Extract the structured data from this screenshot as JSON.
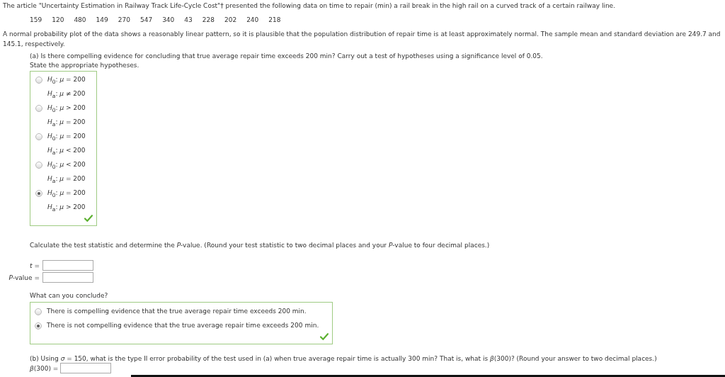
{
  "intro": "The article \"Uncertainty Estimation in Railway Track Life-Cycle Cost\"† presented the following data on time to repair (min) a rail break in the high rail on a curved track of a certain railway line.",
  "data_values": [
    "159",
    "120",
    "480",
    "149",
    "270",
    "547",
    "340",
    "43",
    "228",
    "202",
    "240",
    "218"
  ],
  "description": "A normal probability plot of the data shows a reasonably linear pattern, so it is plausible that the population distribution of repair time is at least approximately normal. The sample mean and standard deviation are 249.7 and 145.1, respectively.",
  "part_a": {
    "question": "(a) Is there compelling evidence for concluding that true average repair time exceeds 200 min? Carry out a test of hypotheses using a significance level of 0.05.",
    "prompt": "State the appropriate hypotheses.",
    "correct": true,
    "options": [
      {
        "h0": "*H*$_{0}$: *μ* = 200",
        "ha": "*H*$_{a}$: *μ* ≠ 200",
        "selected": false
      },
      {
        "h0": "*H*$_{0}$: *μ* > 200",
        "ha": "*H*$_{a}$: *μ* = 200",
        "selected": false
      },
      {
        "h0": "*H*$_{0}$: *μ* = 200",
        "ha": "*H*$_{a}$: *μ* < 200",
        "selected": false
      },
      {
        "h0": "*H*$_{0}$: *μ* < 200",
        "ha": "*H*$_{a}$: *μ* = 200",
        "selected": false
      },
      {
        "h0": "*H*$_{0}$: *μ* = 200",
        "ha": "*H*$_{a}$: *μ* > 200",
        "selected": true
      }
    ]
  },
  "statistic": {
    "instruction": "Calculate the test statistic and determine the *P*-value. (Round your test statistic to two decimal places and your *P*-value to four decimal places.)",
    "fields": [
      {
        "label": "*t* ="
      },
      {
        "label": "*P*-value ="
      }
    ]
  },
  "conclusion": {
    "question": "What can you conclude?",
    "correct": true,
    "options": [
      {
        "text": "There is compelling evidence that the true average repair time exceeds 200 min.",
        "selected": false
      },
      {
        "text": "There is not compelling evidence that the true average repair time exceeds 200 min.",
        "selected": true
      }
    ]
  },
  "part_b": {
    "question": "(b) Using *σ* = 150, what is the type II error probability of the test used in (a) when true average repair time is actually 300 min? That is, what is *β*(300)? (Round your answer to two decimal places.)",
    "field_label": "*β*(300) ="
  }
}
